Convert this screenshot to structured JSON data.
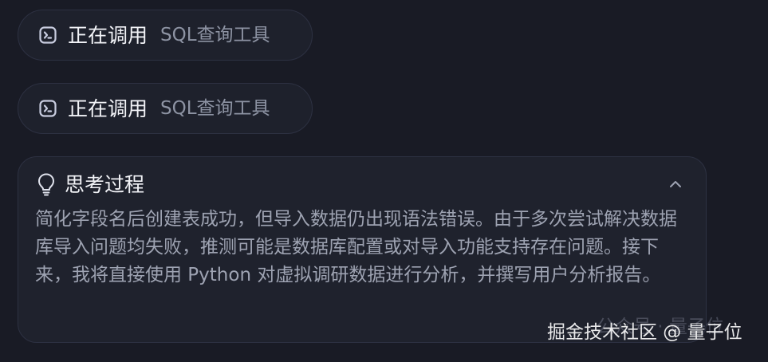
{
  "tool_calls": [
    {
      "status": "正在调用",
      "tool": "SQL查询工具"
    },
    {
      "status": "正在调用",
      "tool": "SQL查询工具"
    }
  ],
  "thinking": {
    "title": "思考过程",
    "body": "简化字段名后创建表成功，但导入数据仍出现语法错误。由于多次尝试解决数据库导入问题均失败，推测可能是数据库配置或对导入功能支持存在问题。接下来，我将直接使用 Python 对虚拟调研数据进行分析，并撰写用户分析报告。"
  },
  "watermark": {
    "text": "掘金技术社区 @ 量子位",
    "faded": "公众号 · 量子位"
  },
  "icons": {
    "terminal": "terminal-icon",
    "bulb": "lightbulb-icon",
    "collapse": "chevron-up-icon"
  },
  "colors": {
    "background": "#191b25",
    "card": "#1f222d",
    "border": "#2d3142",
    "text_primary": "#f2f3f7",
    "text_secondary": "#9ea3b2"
  }
}
